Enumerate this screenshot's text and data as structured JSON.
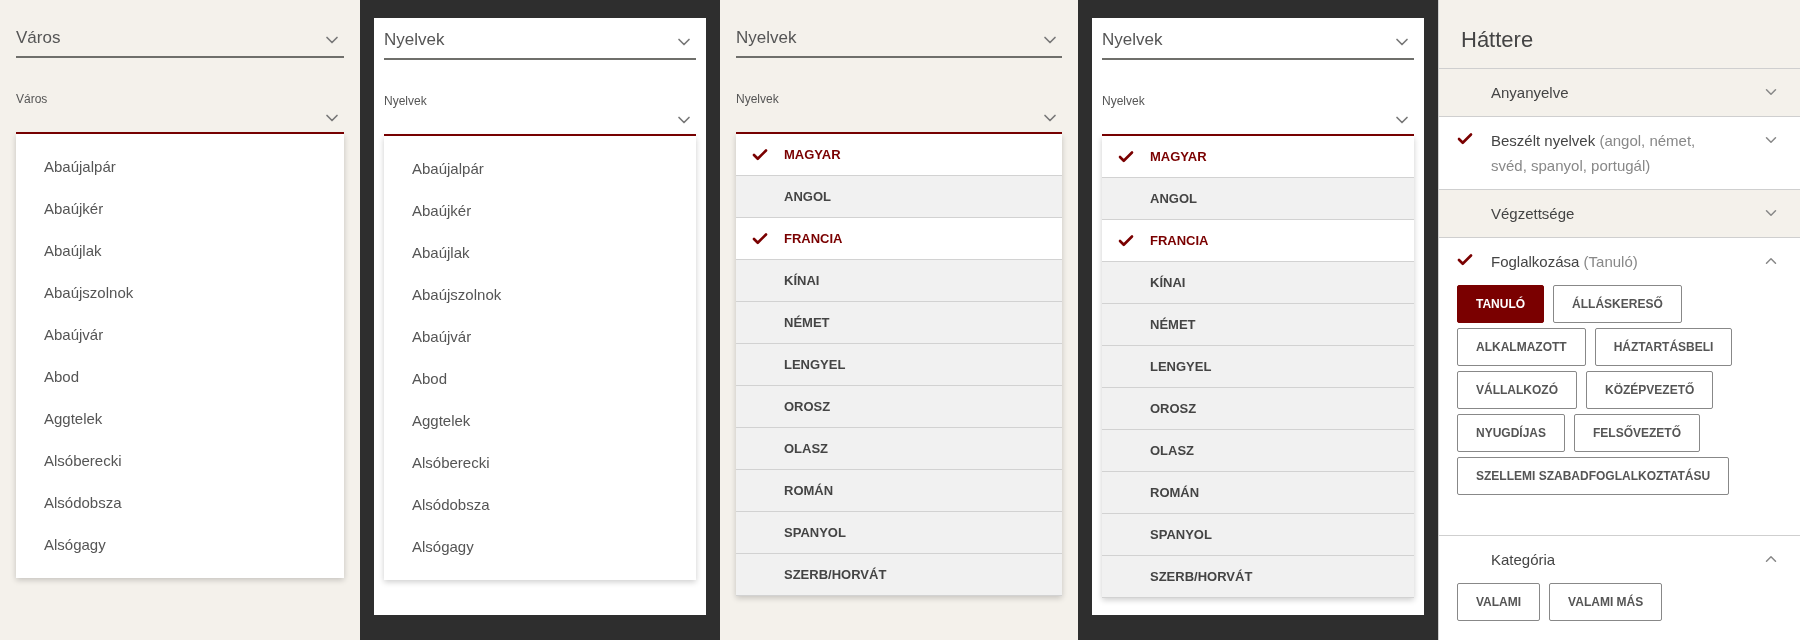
{
  "panels": [
    {
      "kind": "city",
      "framed": false,
      "select": {
        "value": "Város"
      },
      "field": {
        "label": "Város"
      },
      "options": [
        {
          "label": "Abaújalpár"
        },
        {
          "label": "Abaújkér"
        },
        {
          "label": "Abaújlak"
        },
        {
          "label": "Abaújszolnok"
        },
        {
          "label": "Abaújvár"
        },
        {
          "label": "Abod"
        },
        {
          "label": "Aggtelek"
        },
        {
          "label": "Alsóberecki"
        },
        {
          "label": "Alsódobsza"
        },
        {
          "label": "Alsógagy"
        }
      ]
    },
    {
      "kind": "city",
      "framed": true,
      "select": {
        "value": "Nyelvek"
      },
      "field": {
        "label": "Nyelvek"
      },
      "options": [
        {
          "label": "Abaújalpár"
        },
        {
          "label": "Abaújkér"
        },
        {
          "label": "Abaújlak"
        },
        {
          "label": "Abaújszolnok"
        },
        {
          "label": "Abaújvár"
        },
        {
          "label": "Abod"
        },
        {
          "label": "Aggtelek"
        },
        {
          "label": "Alsóberecki"
        },
        {
          "label": "Alsódobsza"
        },
        {
          "label": "Alsógagy"
        }
      ]
    },
    {
      "kind": "language",
      "framed": false,
      "select": {
        "value": "Nyelvek"
      },
      "field": {
        "label": "Nyelvek"
      },
      "options": [
        {
          "label": "MAGYAR",
          "selected": true
        },
        {
          "label": "ANGOL",
          "selected": false
        },
        {
          "label": "FRANCIA",
          "selected": true
        },
        {
          "label": "KÍNAI",
          "selected": false
        },
        {
          "label": "NÉMET",
          "selected": false
        },
        {
          "label": "LENGYEL",
          "selected": false
        },
        {
          "label": "OROSZ",
          "selected": false
        },
        {
          "label": "OLASZ",
          "selected": false
        },
        {
          "label": "ROMÁN",
          "selected": false
        },
        {
          "label": "SPANYOL",
          "selected": false
        },
        {
          "label": "SZERB/HORVÁT",
          "selected": false
        }
      ]
    },
    {
      "kind": "language",
      "framed": true,
      "select": {
        "value": "Nyelvek"
      },
      "field": {
        "label": "Nyelvek"
      },
      "options": [
        {
          "label": "MAGYAR",
          "selected": true
        },
        {
          "label": "ANGOL",
          "selected": false
        },
        {
          "label": "FRANCIA",
          "selected": true
        },
        {
          "label": "KÍNAI",
          "selected": false
        },
        {
          "label": "NÉMET",
          "selected": false
        },
        {
          "label": "LENGYEL",
          "selected": false
        },
        {
          "label": "OROSZ",
          "selected": false
        },
        {
          "label": "OLASZ",
          "selected": false
        },
        {
          "label": "ROMÁN",
          "selected": false
        },
        {
          "label": "SPANYOL",
          "selected": false
        },
        {
          "label": "SZERB/HORVÁT",
          "selected": false
        }
      ]
    }
  ],
  "sidebar": {
    "title": "Háttere",
    "sections": [
      {
        "title": "Anyanyelve",
        "checked": false,
        "expanded": false
      },
      {
        "title": "Beszélt nyelvek",
        "detail": "(angol, német, svéd, spanyol, portugál)",
        "checked": true,
        "expanded": false
      },
      {
        "title": "Végzettsége",
        "checked": false,
        "expanded": false
      },
      {
        "title": "Foglalkozása",
        "detail": "(Tanuló)",
        "checked": true,
        "expanded": true,
        "chips": [
          {
            "label": "TANULÓ",
            "selected": true
          },
          {
            "label": "ÁLLÁSKERESŐ",
            "selected": false
          },
          {
            "label": "ALKALMAZOTT",
            "selected": false
          },
          {
            "label": "HÁZTARTÁSBELI",
            "selected": false
          },
          {
            "label": "VÁLLALKOZÓ",
            "selected": false
          },
          {
            "label": "KÖZÉPVEZETŐ",
            "selected": false
          },
          {
            "label": "NYUGDÍJAS",
            "selected": false
          },
          {
            "label": "FELSŐVEZETŐ",
            "selected": false
          },
          {
            "label": "SZELLEMI SZABADFOGLALKOZTATÁSU",
            "selected": false
          }
        ]
      },
      {
        "title": "Kategória",
        "checked": false,
        "expanded": true,
        "chips": [
          {
            "label": "VALAMI",
            "selected": false
          },
          {
            "label": "VALAMI MÁS",
            "selected": false
          }
        ]
      }
    ]
  }
}
